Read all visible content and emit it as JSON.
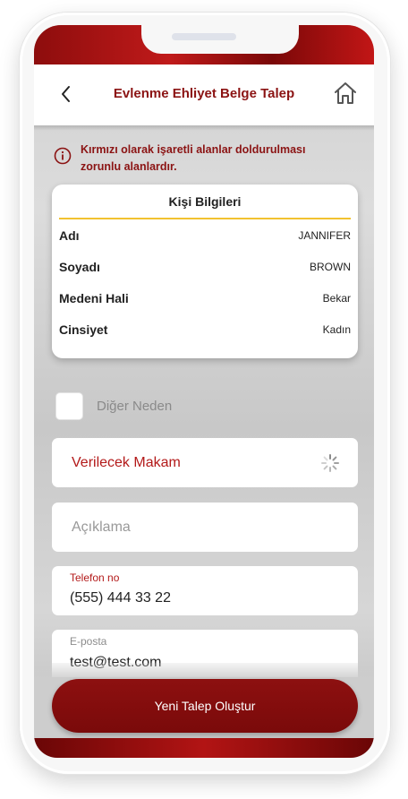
{
  "header": {
    "title": "Evlenme Ehliyet Belge Talep",
    "back_icon": "chevron-left-icon",
    "home_icon": "home-icon"
  },
  "warning": {
    "icon": "info-circle-icon",
    "text": "Kırmızı olarak işaretli alanlar doldurulması zorunlu alanlardır."
  },
  "card": {
    "title": "Kişi Bilgileri",
    "rows": [
      {
        "label": "Adı",
        "value": "JANNIFER"
      },
      {
        "label": "Soyadı",
        "value": "BROWN"
      },
      {
        "label": "Medeni Hali",
        "value": "Bekar"
      },
      {
        "label": "Cinsiyet",
        "value": "Kadın"
      }
    ]
  },
  "checkbox": {
    "label": "Diğer Neden",
    "checked": false
  },
  "fields": {
    "makam": {
      "placeholder": "Verilecek Makam",
      "icon": "loading-spinner-icon"
    },
    "aciklama": {
      "placeholder": "Açıklama"
    },
    "telefon": {
      "label": "Telefon no",
      "value": "(555) 444 33 22"
    },
    "eposta": {
      "label": "E-posta",
      "value": "test@test.com"
    }
  },
  "submit": {
    "label": "Yeni Talep Oluştur"
  },
  "colors": {
    "brand_red": "#8b1313",
    "accent_yellow": "#f2c230",
    "required_red": "#b31919"
  }
}
